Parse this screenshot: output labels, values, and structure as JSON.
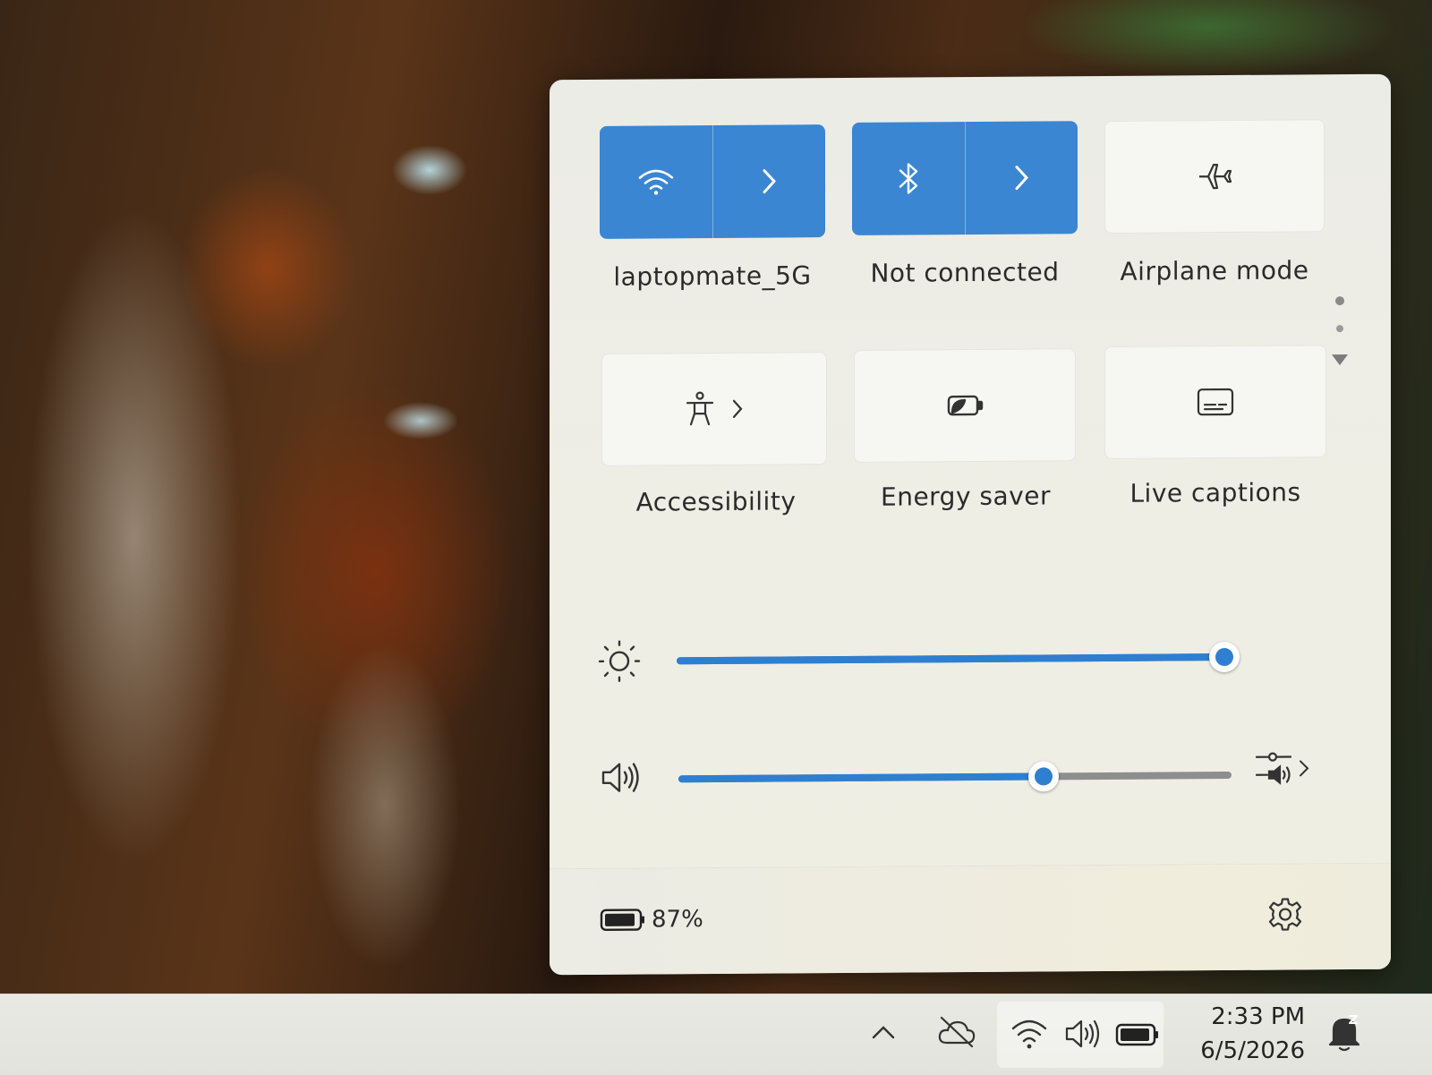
{
  "quick_settings": {
    "tiles": [
      {
        "id": "wifi",
        "label": "laptopmate_5G",
        "icon": "wifi-icon",
        "state": "on"
      },
      {
        "id": "bluetooth",
        "label": "Not connected",
        "icon": "bluetooth-icon",
        "state": "on"
      },
      {
        "id": "airplane",
        "label": "Airplane mode",
        "icon": "airplane-icon",
        "state": "off"
      },
      {
        "id": "accessibility",
        "label": "Accessibility",
        "icon": "accessibility-icon",
        "state": "off"
      },
      {
        "id": "energy_saver",
        "label": "Energy saver",
        "icon": "energy-saver-icon",
        "state": "off"
      },
      {
        "id": "live_captions",
        "label": "Live captions",
        "icon": "live-captions-icon",
        "state": "off"
      }
    ],
    "brightness": {
      "icon": "brightness-icon",
      "level": 1.0
    },
    "volume": {
      "icon": "speaker-icon",
      "level": 0.66,
      "output_icon": "audio-output-icon"
    },
    "battery": {
      "icon": "battery-icon",
      "percent_text": "87%"
    },
    "settings_icon": "gear-icon",
    "accent_color": "#3a86d2"
  },
  "taskbar": {
    "tray_icons": [
      "chevron-up-icon",
      "onedrive-off-icon",
      "wifi-icon",
      "speaker-icon",
      "battery-icon"
    ],
    "time": "2:33 PM",
    "date": "6/5/2026",
    "notification_icon": "notifications-dnd-icon"
  }
}
